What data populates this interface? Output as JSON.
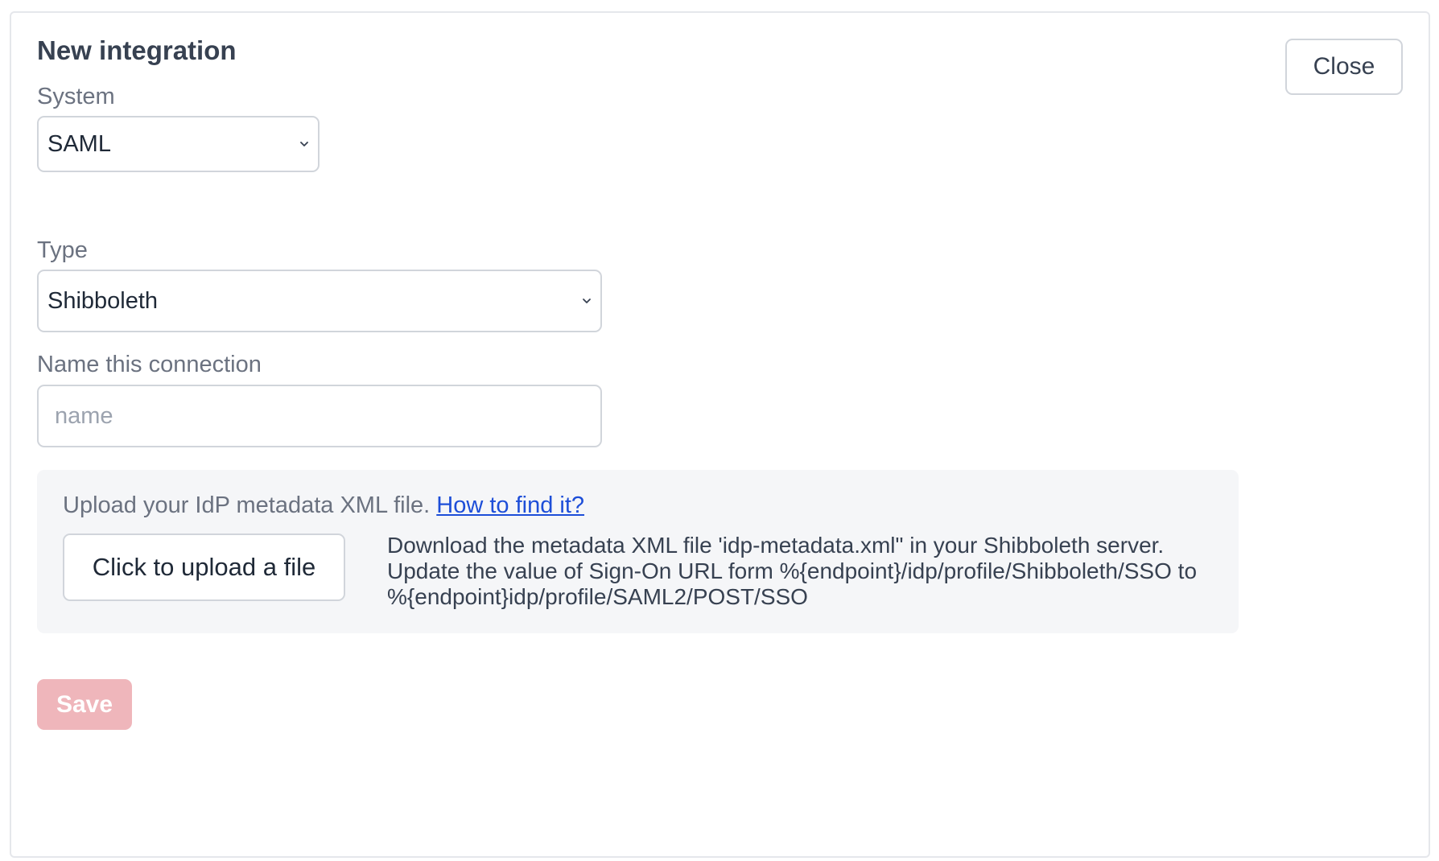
{
  "dialog": {
    "title": "New integration",
    "close_label": "Close"
  },
  "system_field": {
    "label": "System",
    "value": "SAML"
  },
  "type_field": {
    "label": "Type",
    "value": "Shibboleth"
  },
  "name_field": {
    "label": "Name this connection",
    "value": "",
    "placeholder": "name"
  },
  "upload": {
    "prompt": "Upload your IdP metadata XML file.",
    "help_link": "How to find it?",
    "button_label": "Click to upload a file",
    "description": "Download the metadata XML file 'idp-metadata.xml\" in your Shibboleth server. Update the value of Sign-On URL form %{endpoint}/idp/profile/Shibboleth/SSO to %{endpoint}idp/profile/SAML2/POST/SSO"
  },
  "save": {
    "label": "Save",
    "disabled": true
  },
  "colors": {
    "save_disabled_bg": "#efb6bb",
    "link": "#1d4ed8",
    "upload_bg": "#f5f6f8"
  }
}
